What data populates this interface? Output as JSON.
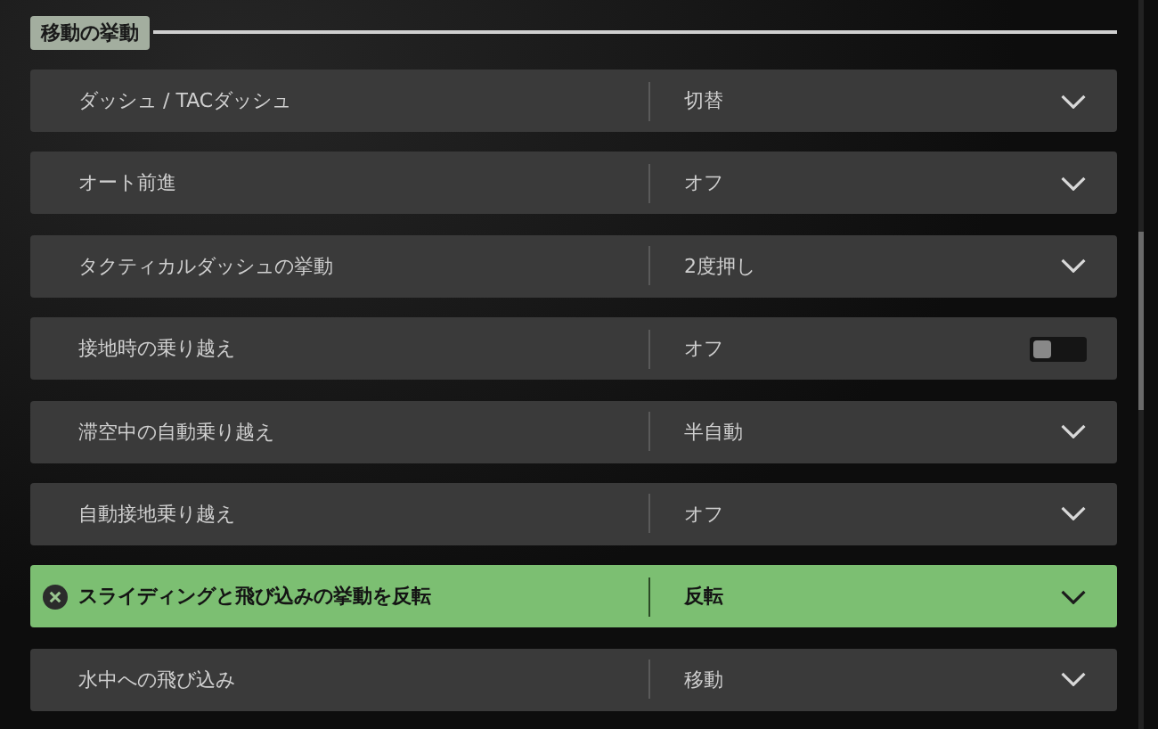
{
  "section": {
    "title": "移動の挙動"
  },
  "settings": [
    {
      "label": "ダッシュ / TACダッシュ",
      "value": "切替",
      "kind": "dropdown",
      "selected": false
    },
    {
      "label": "オート前進",
      "value": "オフ",
      "kind": "dropdown",
      "selected": false
    },
    {
      "label": "タクティカルダッシュの挙動",
      "value": "2度押し",
      "kind": "dropdown",
      "selected": false
    },
    {
      "label": "接地時の乗り越え",
      "value": "オフ",
      "kind": "toggle",
      "on": false,
      "selected": false
    },
    {
      "label": "滞空中の自動乗り越え",
      "value": "半自動",
      "kind": "dropdown",
      "selected": false
    },
    {
      "label": "自動接地乗り越え",
      "value": "オフ",
      "kind": "dropdown",
      "selected": false
    },
    {
      "label": "スライディングと飛び込みの挙動を反転",
      "value": "反転",
      "kind": "dropdown",
      "selected": true
    },
    {
      "label": "水中への飛び込み",
      "value": "移動",
      "kind": "dropdown",
      "selected": false
    }
  ]
}
